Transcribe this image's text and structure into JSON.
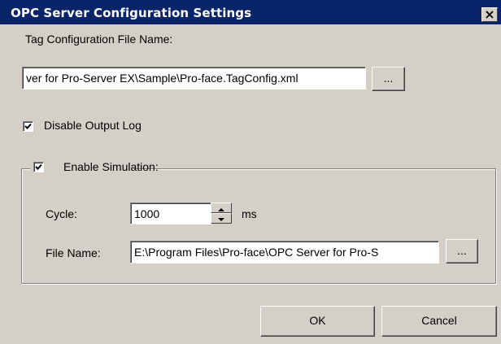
{
  "window": {
    "title": "OPC Server Configuration Settings",
    "close_glyph": "×"
  },
  "tag_config": {
    "label": "Tag Configuration File Name:",
    "value": "ver for Pro-Server EX\\Sample\\Pro-face.TagConfig.xml",
    "browse_label": "..."
  },
  "disable_output_log": {
    "label": "Disable Output Log",
    "checked": true
  },
  "simulation": {
    "label": "Enable Simulation:",
    "checked": true,
    "cycle_label": "Cycle:",
    "cycle_value": "1000",
    "cycle_unit": "ms",
    "file_label": "File Name:",
    "file_value": "E:\\Program Files\\Pro-face\\OPC Server for Pro-S",
    "file_browse_label": "..."
  },
  "buttons": {
    "ok": "OK",
    "cancel": "Cancel"
  },
  "icons": {
    "close": "close-icon",
    "check": "checkmark-icon",
    "spin_up": "spin-up-arrow-icon",
    "spin_down": "spin-down-arrow-icon"
  }
}
